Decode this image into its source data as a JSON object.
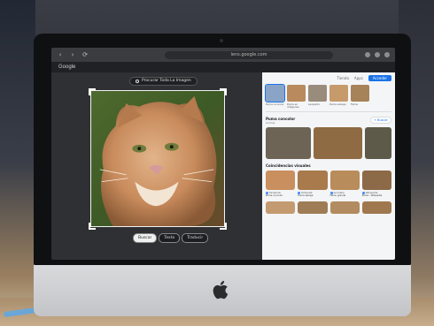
{
  "browser": {
    "url": "lens.google.com",
    "brand": "Google",
    "back_glyph": "‹",
    "forward_glyph": "›",
    "reload_glyph": "⟳"
  },
  "lens": {
    "search_pill_label": "Procurar Toda La Imagen",
    "modes": [
      "Buscar",
      "Texto",
      "Traducir"
    ],
    "active_mode": 0
  },
  "results": {
    "top_links": [
      "Tienda",
      "Apps"
    ],
    "login_label": "Acceder",
    "chips": [
      {
        "caption": "Puma concolor",
        "color": "#8aa4c8"
      },
      {
        "caption": "Puma en imágenes",
        "color": "#b88a5e"
      },
      {
        "caption": "Leopardo",
        "color": "#9a8c7c"
      },
      {
        "caption": "Puma salvaje",
        "color": "#c69a6a"
      },
      {
        "caption": "Felino",
        "color": "#a7835a"
      }
    ],
    "section1_title": "Puma concolor",
    "section1_sub": "Animal",
    "section1_action": "+ Buscar",
    "section2_title": "Coincidencias visuales",
    "related": [
      {
        "color": "#6d6456",
        "flex": 1.2
      },
      {
        "color": "#8f6b43",
        "flex": 1.3
      },
      {
        "color": "#5e5a4a",
        "flex": 0.7
      }
    ],
    "matches": [
      {
        "src": "Facebook",
        "title": "Puma concolor",
        "color": "#c98f5f"
      },
      {
        "src": "Pinterest",
        "title": "Puma salvaje",
        "color": "#a87a4c"
      },
      {
        "src": "Animalia",
        "title": "Felino grande",
        "color": "#b98c5c"
      },
      {
        "src": "Wikipedia",
        "title": "Puma - Wikipedia",
        "color": "#8d6a47"
      }
    ],
    "bottom": [
      {
        "color": "#c49a70"
      },
      {
        "color": "#9e7d56"
      },
      {
        "color": "#b38b61"
      },
      {
        "color": "#a0784f"
      }
    ]
  }
}
